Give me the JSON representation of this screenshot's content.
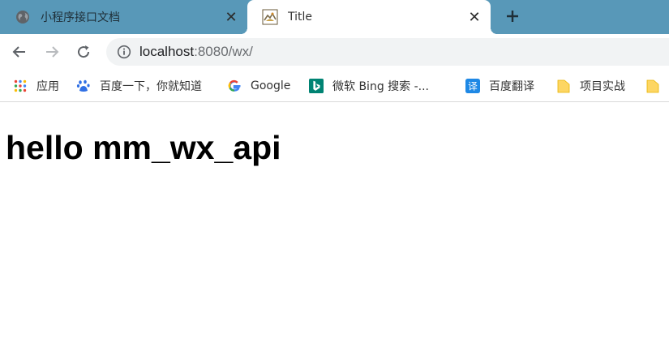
{
  "tabs": [
    {
      "title": "小程序接口文档",
      "icon": "globe-icon",
      "active": false
    },
    {
      "title": "Title",
      "icon": "tomcat-icon",
      "active": true
    }
  ],
  "toolbar": {
    "url_host": "localhost",
    "url_path": ":8080/wx/"
  },
  "bookmarks": [
    {
      "label": "应用",
      "icon": "apps-grid-icon"
    },
    {
      "label": "百度一下，你就知道",
      "icon": "baidu-paw-icon"
    },
    {
      "label": "Google",
      "icon": "google-icon"
    },
    {
      "label": "微软 Bing 搜索 -...",
      "icon": "bing-icon"
    },
    {
      "label": "百度翻译",
      "icon": "translate-icon"
    },
    {
      "label": "项目实战",
      "icon": "folder-icon"
    },
    {
      "label": "",
      "icon": "folder-icon"
    }
  ],
  "page": {
    "heading": "hello mm_wx_api"
  },
  "colors": {
    "tabstrip": "#5898b8",
    "omnibox": "#f1f3f4",
    "bing": "#008373",
    "translate": "#1e88e5",
    "folder": "#fdd663"
  }
}
